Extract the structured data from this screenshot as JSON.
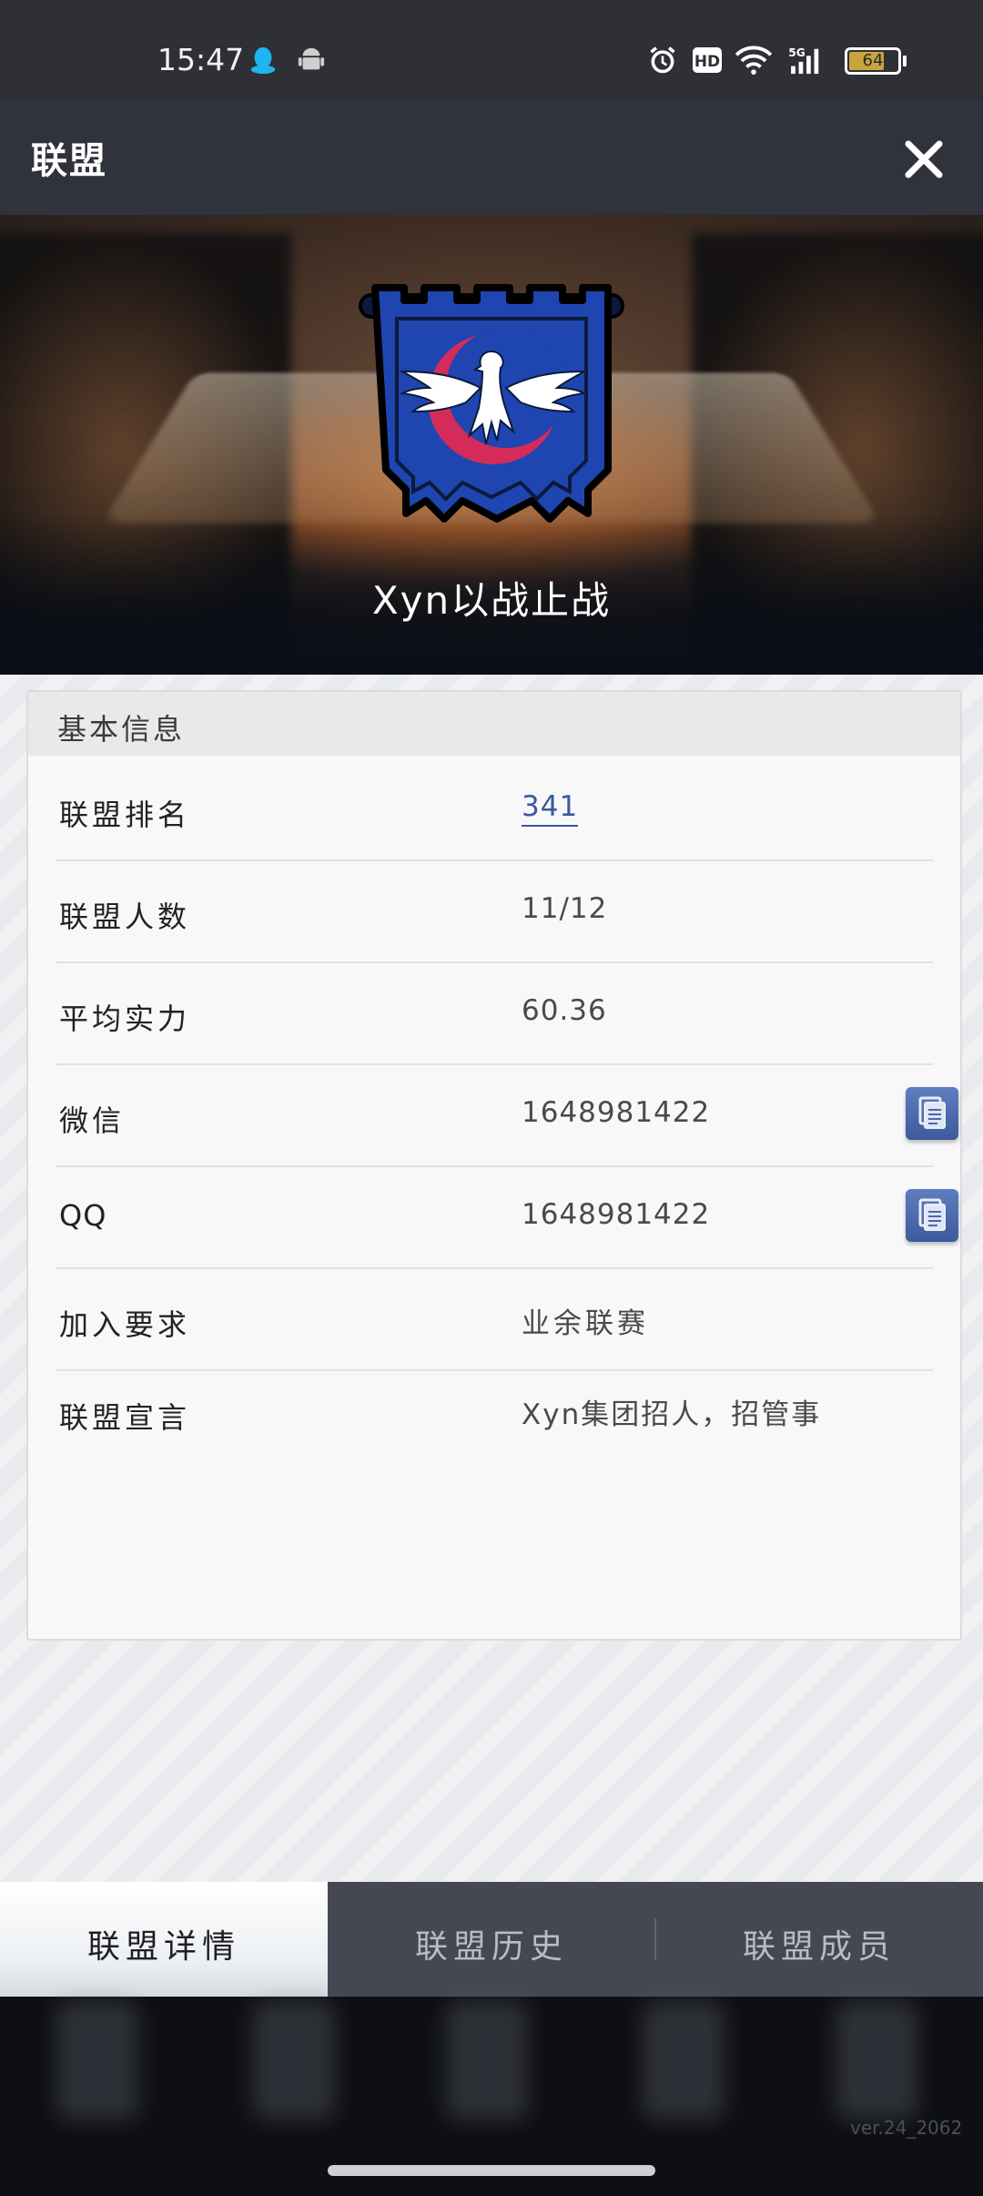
{
  "status_bar": {
    "time": "15:47",
    "battery": "64",
    "icons": [
      "qq-icon",
      "android-icon",
      "alarm-icon",
      "hd-icon",
      "wifi-icon",
      "5g-signal-icon",
      "battery-icon"
    ]
  },
  "header": {
    "title": "联盟",
    "close_icon": "close-icon"
  },
  "banner": {
    "alliance_name": "Xyn以战止战",
    "emblem_icon": "eagle-emblem-icon"
  },
  "info": {
    "section_title": "基本信息",
    "rows": [
      {
        "label": "联盟排名",
        "value": "341"
      },
      {
        "label": "联盟人数",
        "value": "11/12"
      },
      {
        "label": "平均实力",
        "value": "60.36"
      },
      {
        "label": "微信",
        "value": "1648981422"
      },
      {
        "label": "QQ",
        "value": "1648981422"
      },
      {
        "label": "加入要求",
        "value": "业余联赛"
      },
      {
        "label": "联盟宣言",
        "value": "Xyn集团招人，招管事"
      }
    ]
  },
  "tabs": [
    {
      "label": "联盟详情",
      "active": true
    },
    {
      "label": "联盟历史",
      "active": false
    },
    {
      "label": "联盟成员",
      "active": false
    }
  ],
  "footer": {
    "version": "ver.24_2062"
  },
  "colors": {
    "header_bg": "#30333c",
    "accent_link": "#3b58a0",
    "copy_button": "#4a68ab",
    "emblem_blue": "#2244a8",
    "emblem_red": "#d42b5a"
  }
}
